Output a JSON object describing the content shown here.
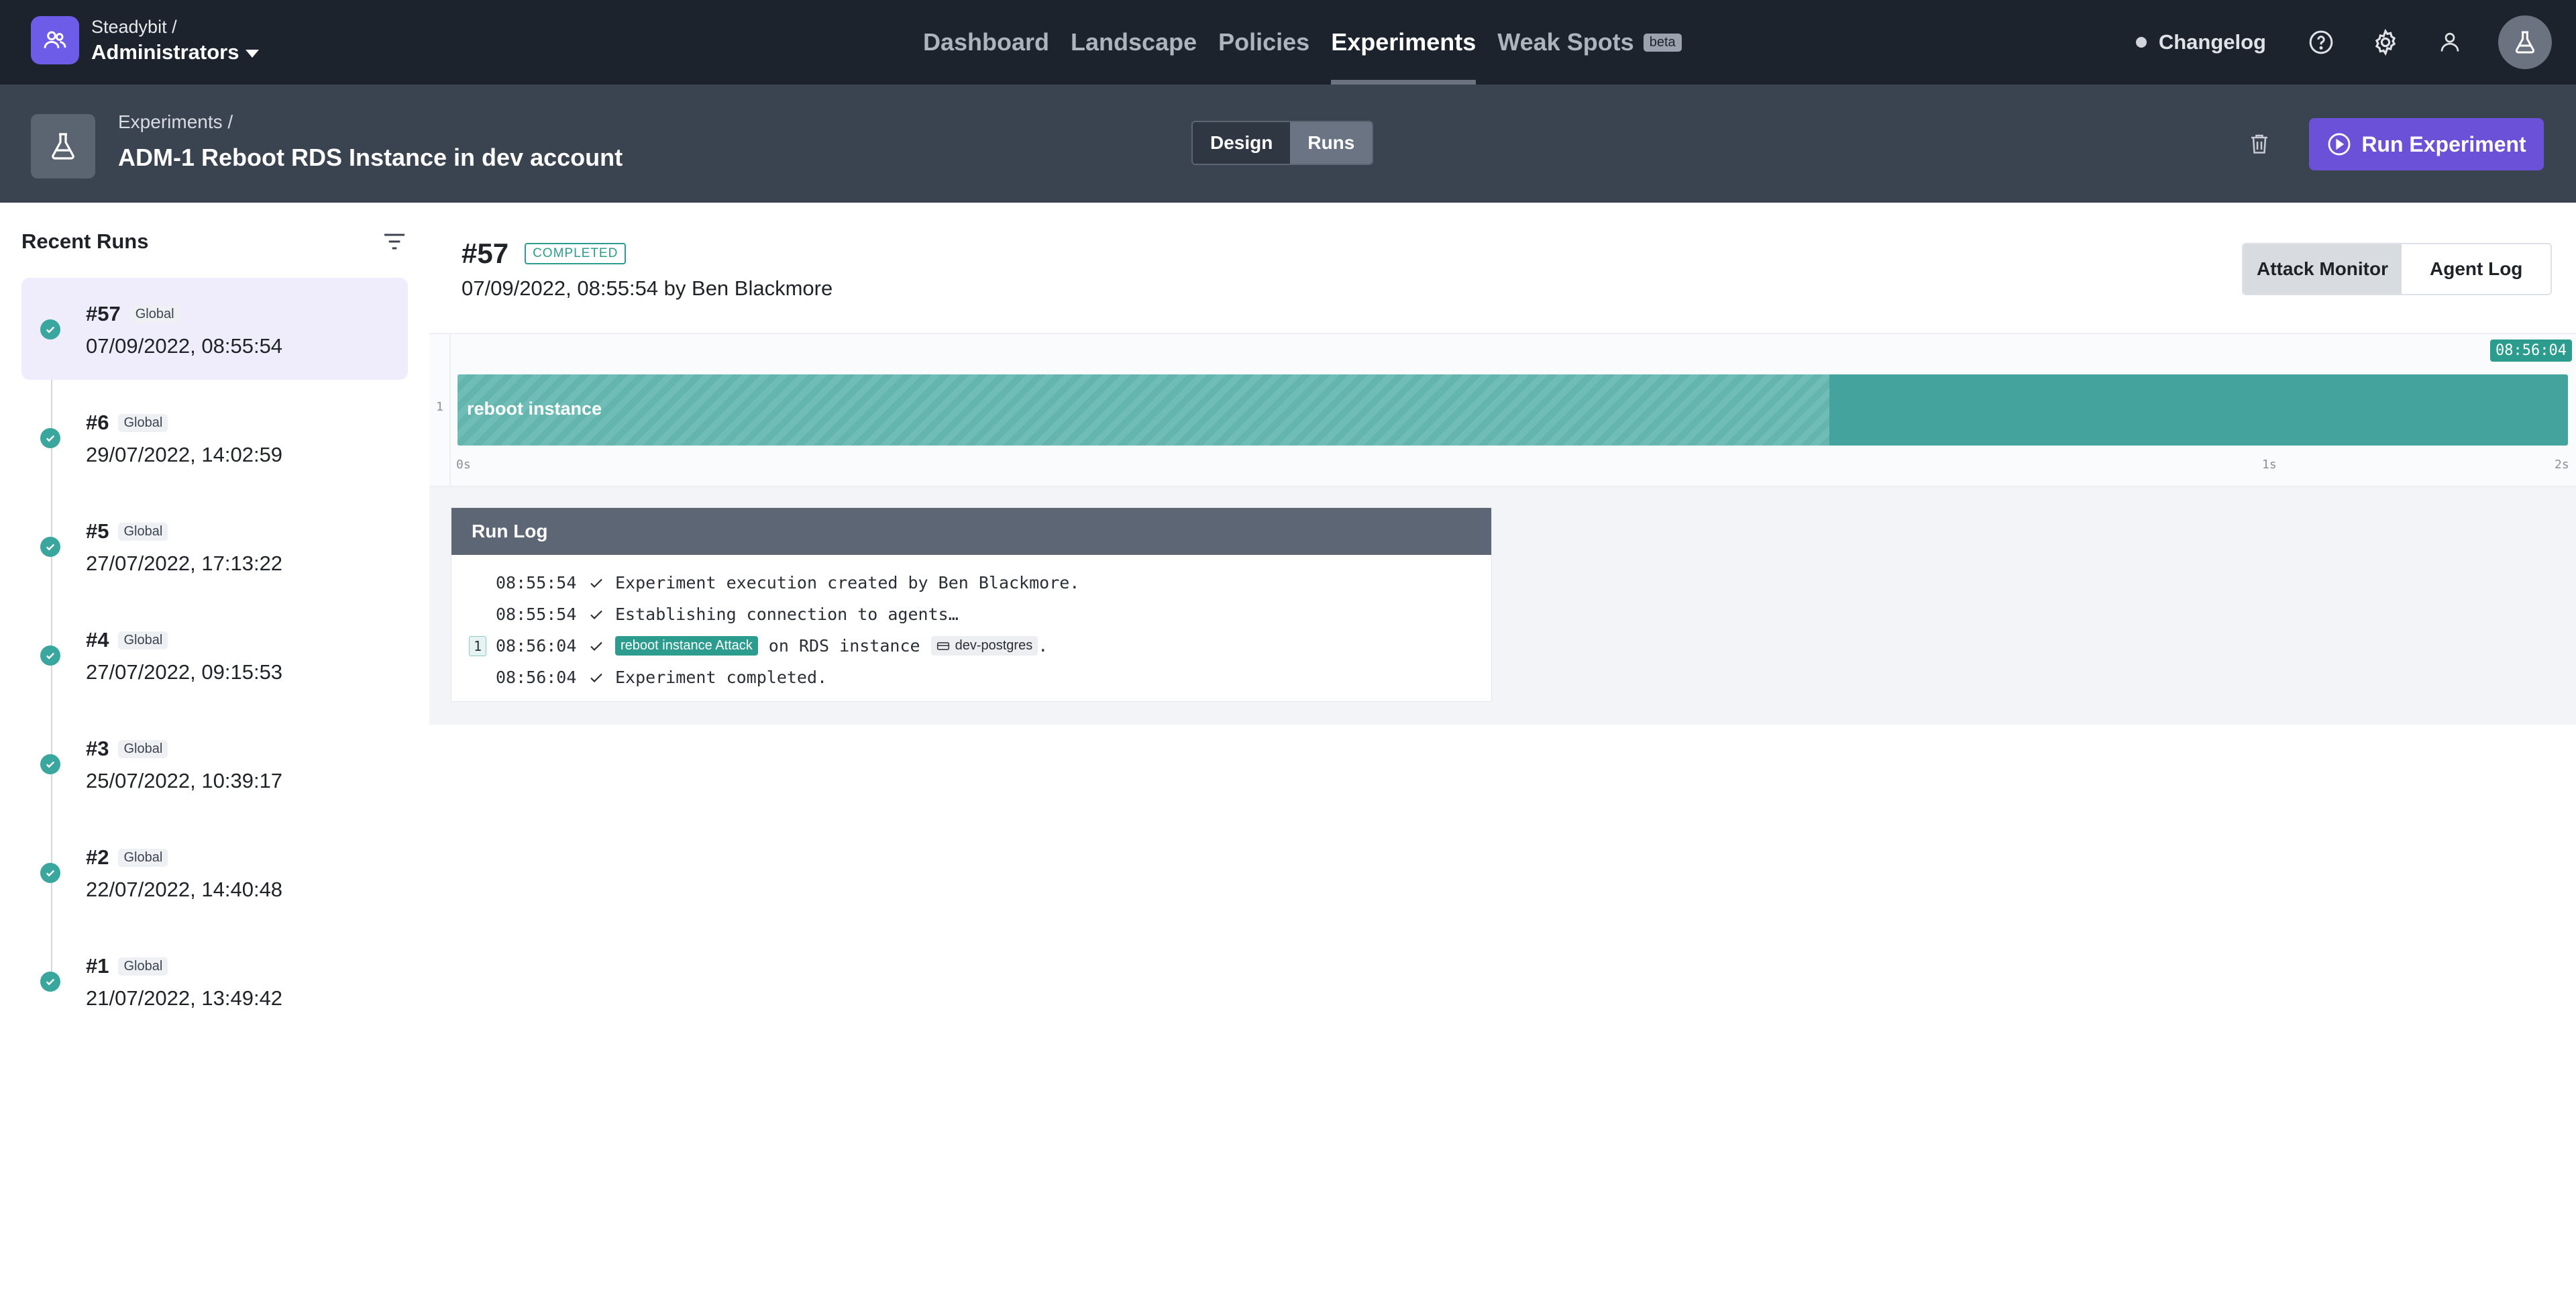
{
  "topnav": {
    "team_prefix": "Steadybit /",
    "team_name": "Administrators",
    "items": [
      {
        "label": "Dashboard",
        "active": false
      },
      {
        "label": "Landscape",
        "active": false
      },
      {
        "label": "Policies",
        "active": false
      },
      {
        "label": "Experiments",
        "active": true
      },
      {
        "label": "Weak Spots",
        "active": false
      }
    ],
    "beta_label": "beta",
    "changelog_label": "Changelog",
    "icons": [
      "help-icon",
      "settings-gear-icon",
      "user-icon",
      "flask-icon"
    ]
  },
  "subheader": {
    "breadcrumb": "Experiments /",
    "title": "ADM-1  Reboot RDS Instance in dev account",
    "tabs": [
      {
        "label": "Design",
        "active": false
      },
      {
        "label": "Runs",
        "active": true
      }
    ],
    "run_button_label": "Run Experiment"
  },
  "sidebar": {
    "title": "Recent Runs",
    "runs": [
      {
        "number": "#57",
        "badge": "Global",
        "date": "07/09/2022, 08:55:54",
        "active": true
      },
      {
        "number": "#6",
        "badge": "Global",
        "date": "29/07/2022, 14:02:59",
        "active": false
      },
      {
        "number": "#5",
        "badge": "Global",
        "date": "27/07/2022, 17:13:22",
        "active": false
      },
      {
        "number": "#4",
        "badge": "Global",
        "date": "27/07/2022, 09:15:53",
        "active": false
      },
      {
        "number": "#3",
        "badge": "Global",
        "date": "25/07/2022, 10:39:17",
        "active": false
      },
      {
        "number": "#2",
        "badge": "Global",
        "date": "22/07/2022, 14:40:48",
        "active": false
      },
      {
        "number": "#1",
        "badge": "Global",
        "date": "21/07/2022, 13:49:42",
        "active": false
      }
    ]
  },
  "run": {
    "number": "#57",
    "status": "COMPLETED",
    "meta": "07/09/2022, 08:55:54 by Ben Blackmore",
    "view_tabs": [
      {
        "label": "Attack Monitor",
        "active": true
      },
      {
        "label": "Agent Log",
        "active": false
      }
    ]
  },
  "timeline": {
    "current_time": "08:56:04",
    "lane_number": "1",
    "step_label": "reboot instance",
    "striped_fraction": 0.65,
    "ticks": [
      "0s",
      "1s",
      "2s"
    ]
  },
  "run_log": {
    "title": "Run Log",
    "lines": [
      {
        "lane": "",
        "time": "08:55:54",
        "text": "Experiment execution created by Ben Blackmore."
      },
      {
        "lane": "",
        "time": "08:55:54",
        "text": "Establishing connection to agents…"
      },
      {
        "lane": "1",
        "time": "08:56:04",
        "attack": "reboot instance Attack",
        "text": "on RDS instance",
        "target": "dev-postgres",
        "suffix": "."
      },
      {
        "lane": "",
        "time": "08:56:04",
        "text": "Experiment completed."
      }
    ]
  },
  "colors": {
    "accent": "#6b50d8",
    "success": "#2c9c8f",
    "topbar": "#1c232c",
    "subheader": "#3a4350"
  }
}
